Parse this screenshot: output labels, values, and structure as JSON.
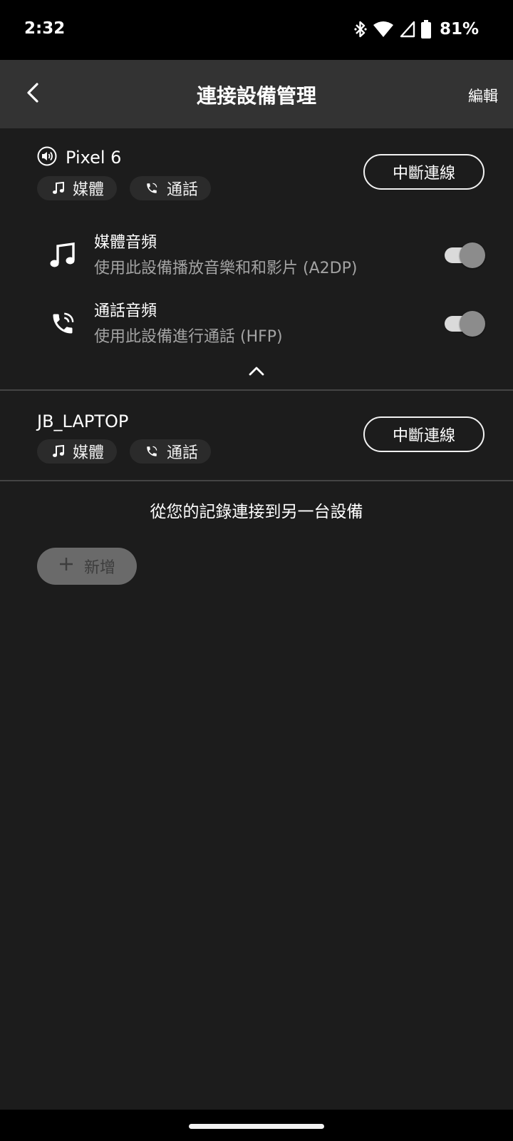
{
  "status_bar": {
    "time": "2:32",
    "battery": "81%",
    "icons": [
      "bluetooth-icon",
      "wifi-icon",
      "cell-signal-icon",
      "battery-icon"
    ]
  },
  "app_bar": {
    "title": "連接設備管理",
    "edit_label": "編輯",
    "back_icon": "chevron-left-icon"
  },
  "devices": [
    {
      "name": "Pixel 6",
      "active_icon": "speaker-icon",
      "chips": [
        {
          "icon": "music-note-icon",
          "label": "媒體"
        },
        {
          "icon": "phone-icon",
          "label": "通話"
        }
      ],
      "disconnect_label": "中斷連線",
      "expanded": true,
      "profiles": [
        {
          "icon": "music-note-icon",
          "title": "媒體音頻",
          "description": "使用此設備播放音樂和和影片 (A2DP)",
          "enabled": true
        },
        {
          "icon": "phone-in-talk-icon",
          "title": "通話音頻",
          "description": "使用此設備進行通話 (HFP)",
          "enabled": true
        }
      ]
    },
    {
      "name": "JB_LAPTOP",
      "chips": [
        {
          "icon": "music-note-icon",
          "label": "媒體"
        },
        {
          "icon": "phone-icon",
          "label": "通話"
        }
      ],
      "disconnect_label": "中斷連線",
      "expanded": false
    }
  ],
  "connect_other": {
    "text": "從您的記錄連接到另一台設備",
    "add_label": "新增",
    "add_icon": "plus-icon"
  },
  "colors": {
    "background": "#1c1c1c",
    "app_bar": "#333333",
    "chip": "#2b2b2b",
    "secondary_text": "#a3a3a3",
    "add_button": "#6a6a6a"
  }
}
